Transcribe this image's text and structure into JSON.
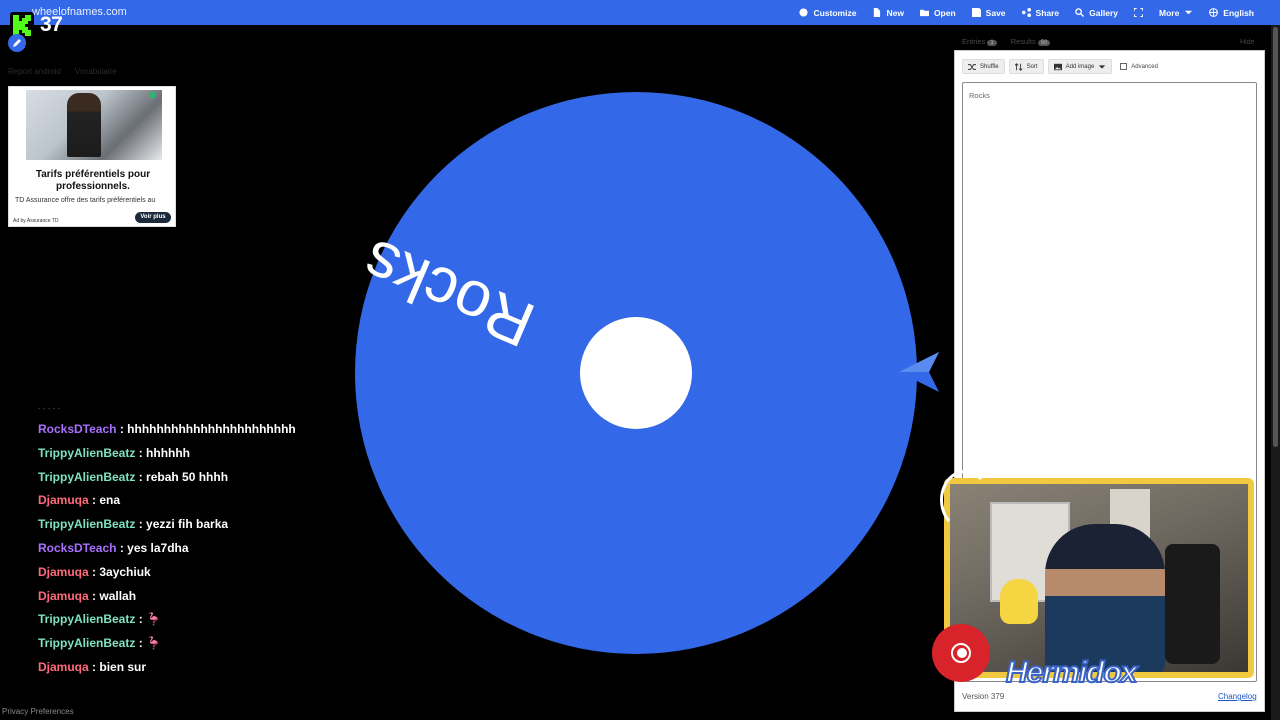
{
  "topbar": {
    "site": "wheelofnames.com",
    "nav": [
      {
        "label": "Customize",
        "icon": "palette-icon"
      },
      {
        "label": "New",
        "icon": "file-icon"
      },
      {
        "label": "Open",
        "icon": "folder-icon"
      },
      {
        "label": "Save",
        "icon": "save-icon"
      },
      {
        "label": "Share",
        "icon": "share-icon"
      },
      {
        "label": "Gallery",
        "icon": "search-icon"
      },
      {
        "label": "",
        "icon": "fullscreen-icon"
      },
      {
        "label": "More",
        "icon": "chevron-down-icon"
      },
      {
        "label": "English",
        "icon": "globe-icon"
      }
    ]
  },
  "overlay": {
    "kick_count": "37",
    "faded_links": [
      "Report android",
      "Vocabulaire"
    ]
  },
  "ad": {
    "title": "Tarifs préférentiels pour professionnels.",
    "description": "TD Assurance offre des tarifs préférentiels au",
    "fine_print": "Ad by Assurance TD",
    "button": "Voir plus"
  },
  "wheel": {
    "color": "#3369e8",
    "entry": "Rocks"
  },
  "chat": {
    "messages": [
      {
        "user": "RocksDTeach",
        "color": "#a970ff",
        "text": "hhhhhhhhhhhhhhhhhhhhhhh"
      },
      {
        "user": "TrippyAlienBeatz",
        "color": "#7fe3c3",
        "text": "hhhhhh"
      },
      {
        "user": "TrippyAlienBeatz",
        "color": "#7fe3c3",
        "text": "rebah 50 hhhh"
      },
      {
        "user": "Djamuqa",
        "color": "#ff6b7d",
        "text": "ena"
      },
      {
        "user": "TrippyAlienBeatz",
        "color": "#7fe3c3",
        "text": "yezzi fih barka"
      },
      {
        "user": "RocksDTeach",
        "color": "#a970ff",
        "text": "yes la7dha"
      },
      {
        "user": "Djamuqa",
        "color": "#ff6b7d",
        "text": "3aychiuk"
      },
      {
        "user": "Djamuqa",
        "color": "#ff6b7d",
        "text": "wallah"
      },
      {
        "user": "TrippyAlienBeatz",
        "color": "#7fe3c3",
        "text": "🦩"
      },
      {
        "user": "TrippyAlienBeatz",
        "color": "#7fe3c3",
        "text": "🦩"
      },
      {
        "user": "Djamuqa",
        "color": "#ff6b7d",
        "text": "bien sur"
      }
    ]
  },
  "panel": {
    "tabs": [
      {
        "label": "Entries",
        "count": "1"
      },
      {
        "label": "Results",
        "count": "50"
      }
    ],
    "hide": "Hide",
    "toolbar": {
      "shuffle": "Shuffle",
      "sort": "Sort",
      "add_image": "Add image",
      "advanced": "Advanced"
    },
    "entries_text": "Rocks",
    "version": "Version 379",
    "changelog": "Changelog"
  },
  "webcam": {
    "streamer": "Hermidox"
  },
  "footer": {
    "privacy": "Privacy Preferences"
  }
}
